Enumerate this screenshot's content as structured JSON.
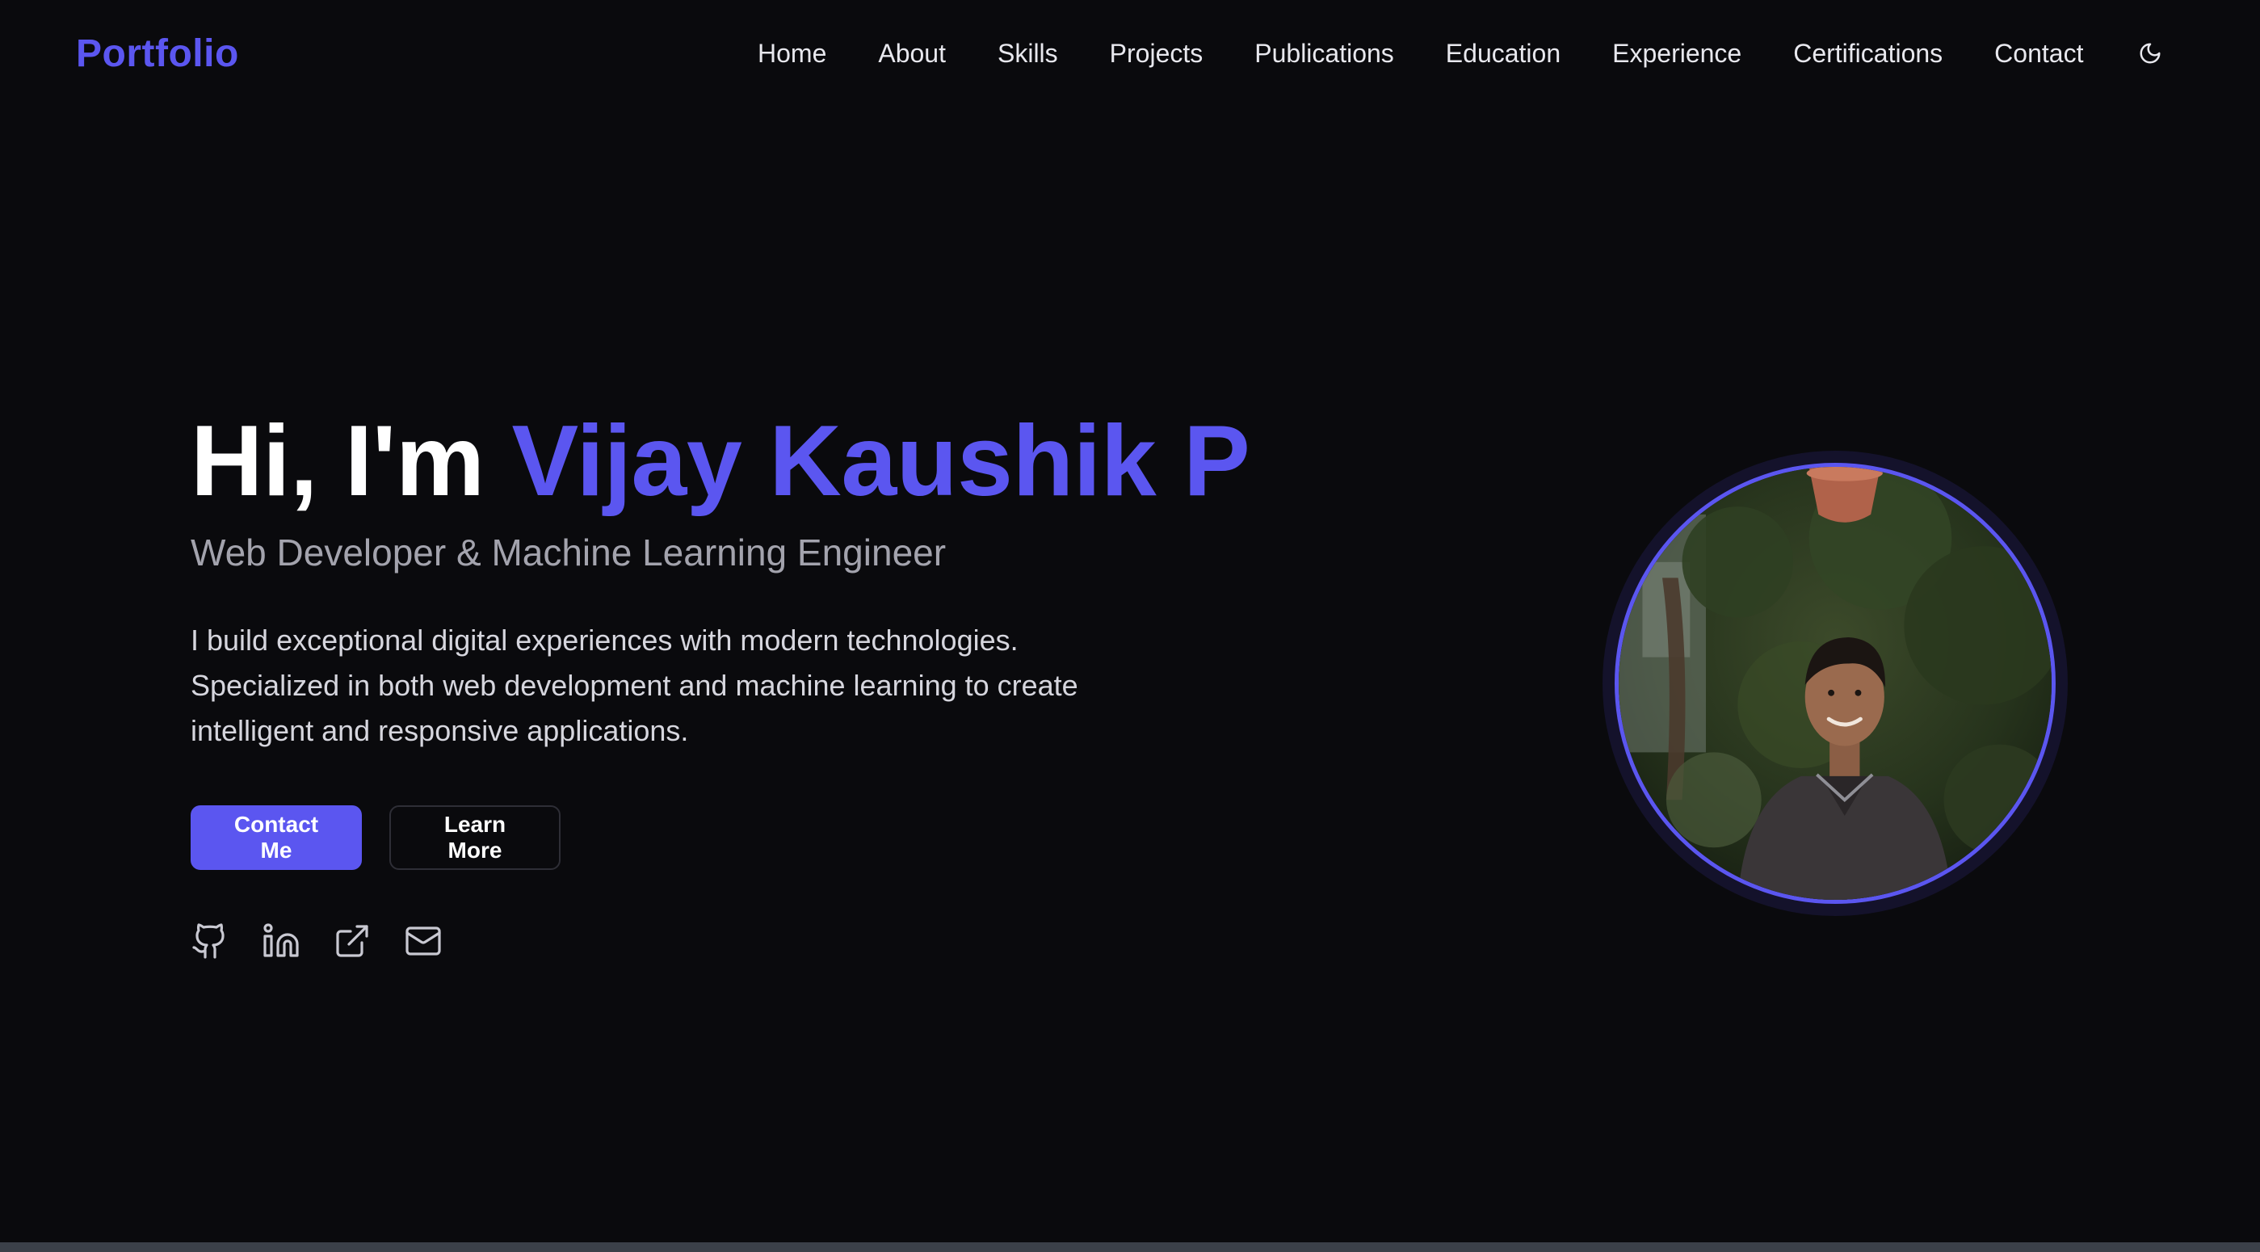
{
  "brand": {
    "label": "Portfolio"
  },
  "nav": {
    "items": [
      {
        "label": "Home"
      },
      {
        "label": "About"
      },
      {
        "label": "Skills"
      },
      {
        "label": "Projects"
      },
      {
        "label": "Publications"
      },
      {
        "label": "Education"
      },
      {
        "label": "Experience"
      },
      {
        "label": "Certifications"
      },
      {
        "label": "Contact"
      }
    ],
    "theme_toggle_icon": "moon-icon"
  },
  "hero": {
    "greeting_prefix": "Hi, I'm ",
    "name": "Vijay Kaushik P",
    "subtitle": "Web Developer & Machine Learning Engineer",
    "description": "I build exceptional digital experiences with modern technologies. Specialized in both web development and machine learning to create intelligent and responsive applications.",
    "primary_button": "Contact Me",
    "secondary_button": "Learn More",
    "social_icons": [
      "github-icon",
      "linkedin-icon",
      "external-link-icon",
      "mail-icon"
    ]
  },
  "colors": {
    "accent": "#5b56f0",
    "background": "#0a0a0d",
    "text": "#ffffff",
    "muted": "#a3a3ad"
  }
}
